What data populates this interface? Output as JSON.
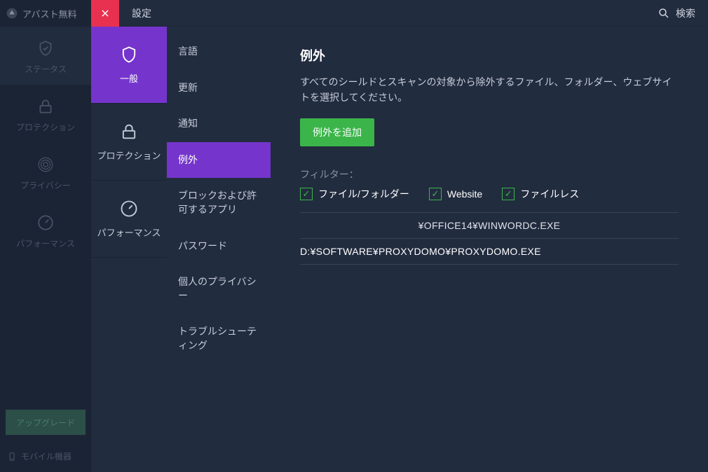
{
  "brand": {
    "text": "アバスト無料"
  },
  "leftnav": {
    "items": [
      {
        "label": "ステータス"
      },
      {
        "label": "プロテクション"
      },
      {
        "label": "プライバシー"
      },
      {
        "label": "パフォーマンス"
      }
    ],
    "upgrade": "アップグレード",
    "mobile": "モバイル機器"
  },
  "modal": {
    "title": "設定",
    "search": "検索"
  },
  "tabs": [
    {
      "label": "一般"
    },
    {
      "label": "プロテクション"
    },
    {
      "label": "パフォーマンス"
    }
  ],
  "subnav": [
    {
      "label": "言語"
    },
    {
      "label": "更新"
    },
    {
      "label": "通知"
    },
    {
      "label": "例外"
    },
    {
      "label": "ブロックおよび許可するアプリ"
    },
    {
      "label": "パスワード"
    },
    {
      "label": "個人のプライバシー"
    },
    {
      "label": "トラブルシューティング"
    }
  ],
  "content": {
    "heading": "例外",
    "description": "すべてのシールドとスキャンの対象から除外するファイル、フォルダー、ウェブサイトを選択してください。",
    "add_button": "例外を追加",
    "filter_label": "フィルター：",
    "filters": [
      {
        "label": "ファイル/フォルダー"
      },
      {
        "label": "Website"
      },
      {
        "label": "ファイルレス"
      }
    ],
    "rows": [
      "¥OFFICE14¥WINWORDC.EXE",
      "D:¥SOFTWARE¥PROXYDOMO¥PROXYDOMO.EXE"
    ]
  },
  "colors": {
    "accent_purple": "#7535cc",
    "accent_green": "#3bb54a",
    "close_red": "#e83150"
  }
}
